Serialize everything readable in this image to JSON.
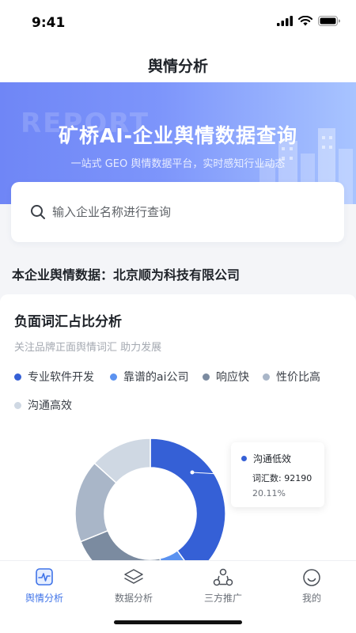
{
  "status_bar": {
    "time": "9:41"
  },
  "nav": {
    "title": "舆情分析"
  },
  "banner": {
    "watermark": "REPORT",
    "title": "矿桥AI-企业舆情数据查询",
    "subtitle": "一站式 GEO 舆情数据平台，实时感知行业动态"
  },
  "search": {
    "placeholder": "输入企业名称进行查询",
    "value": ""
  },
  "company": {
    "label": "本企业舆情数据：北京顺为科技有限公司"
  },
  "card": {
    "title": "负面词汇占比分析",
    "subtitle": "关注品牌正面舆情词汇 助力发展"
  },
  "chart_data": {
    "type": "pie",
    "series": [
      {
        "name": "专业软件开发",
        "color": "#3560d6"
      },
      {
        "name": "靠谱的ai公司",
        "color": "#5b92f0"
      },
      {
        "name": "响应快",
        "color": "#7b8ba0"
      },
      {
        "name": "性价比高",
        "color": "#a9b6c8"
      },
      {
        "name": "沟通高效",
        "color": "#cfd8e3"
      }
    ],
    "visible_slices": [
      {
        "color": "#3560d6",
        "percent": 36
      },
      {
        "color": "#5b92f0",
        "percent": 6
      },
      {
        "color": "#7b8ba0",
        "percent": 20
      },
      {
        "color": "#a9b6c8",
        "percent": 16
      },
      {
        "color": "#cfd8e3",
        "percent": 12
      }
    ],
    "tooltip": {
      "name": "沟通低效",
      "value_label": "词汇数: 92190",
      "percent_label": "20.11%"
    }
  },
  "tabs": [
    {
      "label": "舆情分析",
      "icon": "pulse-icon",
      "active": true
    },
    {
      "label": "数据分析",
      "icon": "layers-icon",
      "active": false
    },
    {
      "label": "三方推广",
      "icon": "network-icon",
      "active": false
    },
    {
      "label": "我的",
      "icon": "smile-icon",
      "active": false
    }
  ],
  "colors": {
    "accent": "#3f73e8",
    "banner_start": "#6f86f6",
    "banner_end": "#a8c4ff"
  }
}
